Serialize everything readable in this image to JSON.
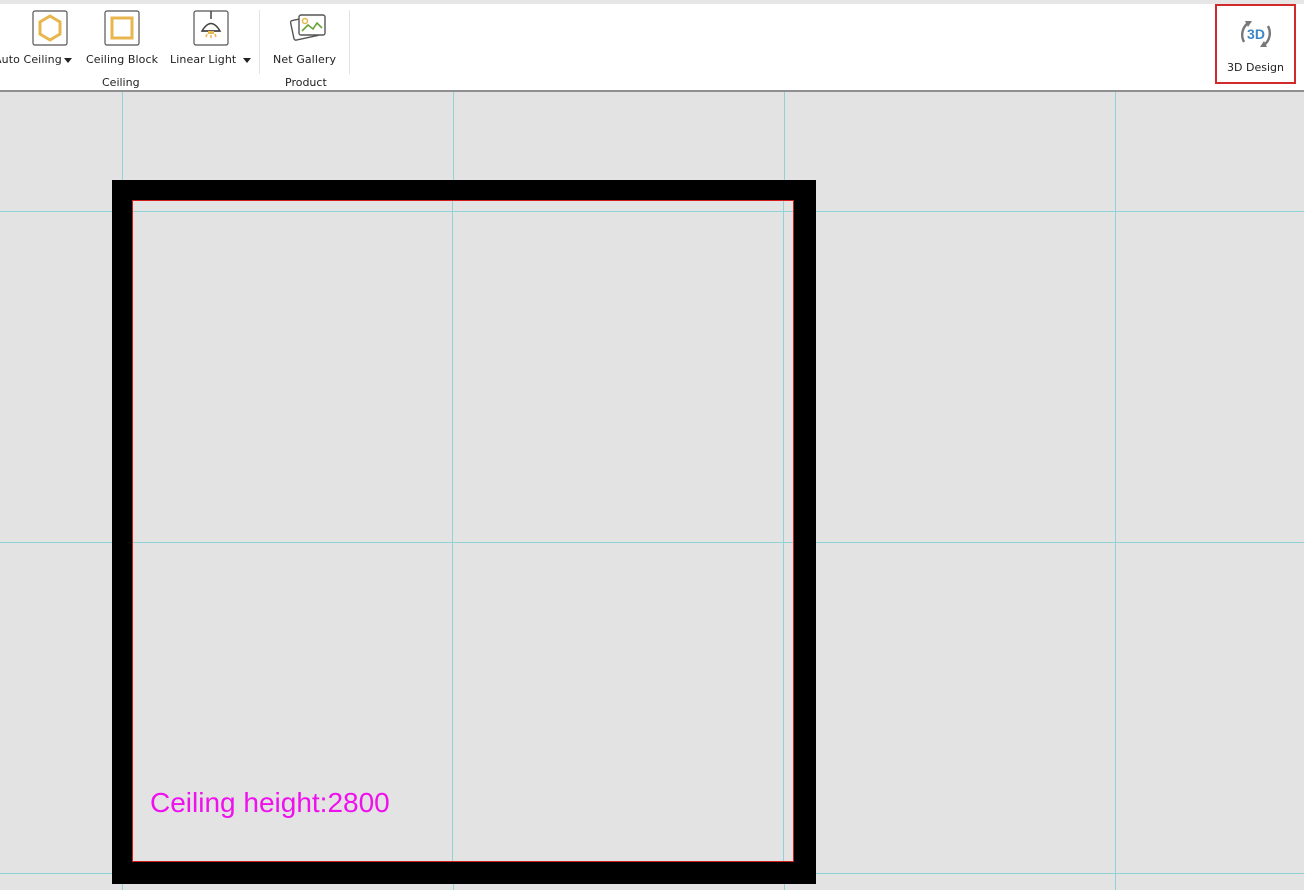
{
  "ribbon": {
    "buttons": [
      {
        "label": "Auto Ceiling",
        "icon": "hexagon-ceiling-icon",
        "has_dropdown": true
      },
      {
        "label": "Ceiling Block",
        "icon": "ceiling-block-icon",
        "has_dropdown": false
      },
      {
        "label": "Linear Light",
        "icon": "pendant-lamp-icon",
        "has_dropdown": true
      },
      {
        "label": "Net Gallery",
        "icon": "gallery-images-icon",
        "has_dropdown": false
      }
    ],
    "groups": [
      {
        "label": "Ceiling"
      },
      {
        "label": "Product"
      }
    ],
    "design3d": {
      "label": "3D Design",
      "icon_text": "3D",
      "icon": "3d-rotate-icon"
    }
  },
  "canvas": {
    "ceiling_label": "Ceiling height:2800"
  },
  "colors": {
    "accent_icon": "#e8b64c",
    "highlight_border": "#d22a2a",
    "grid_line": "#8fd3d6",
    "room_outline": "#d31c1c",
    "ceiling_text": "#ee11ee",
    "canvas_bg": "#e3e3e3"
  }
}
